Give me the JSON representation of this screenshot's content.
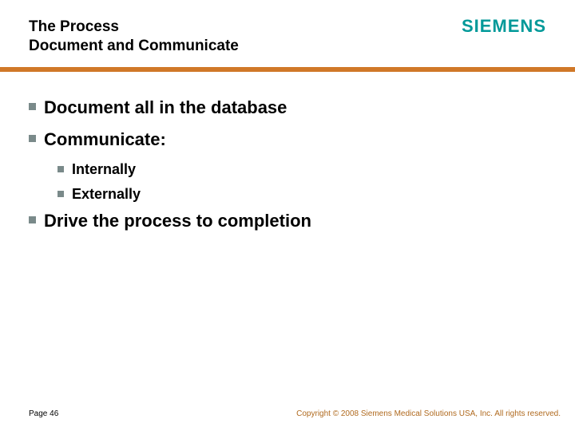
{
  "header": {
    "title_line1": "The Process",
    "title_line2": "Document and Communicate",
    "logo_text": "SIEMENS"
  },
  "bullets": [
    {
      "level": 1,
      "text": "Document all in the database"
    },
    {
      "level": 1,
      "text": "Communicate:"
    },
    {
      "level": 2,
      "text": "Internally"
    },
    {
      "level": 2,
      "text": "Externally"
    },
    {
      "level": 1,
      "text": "Drive the process to completion"
    }
  ],
  "footer": {
    "page_label": "Page 46",
    "copyright": "Copyright © 2008 Siemens Medical Solutions USA, Inc. All rights reserved."
  },
  "colors": {
    "accent_bar": "#d07828",
    "logo": "#009999",
    "bullet": "#7a8a8a",
    "copyright": "#b06a1f"
  }
}
